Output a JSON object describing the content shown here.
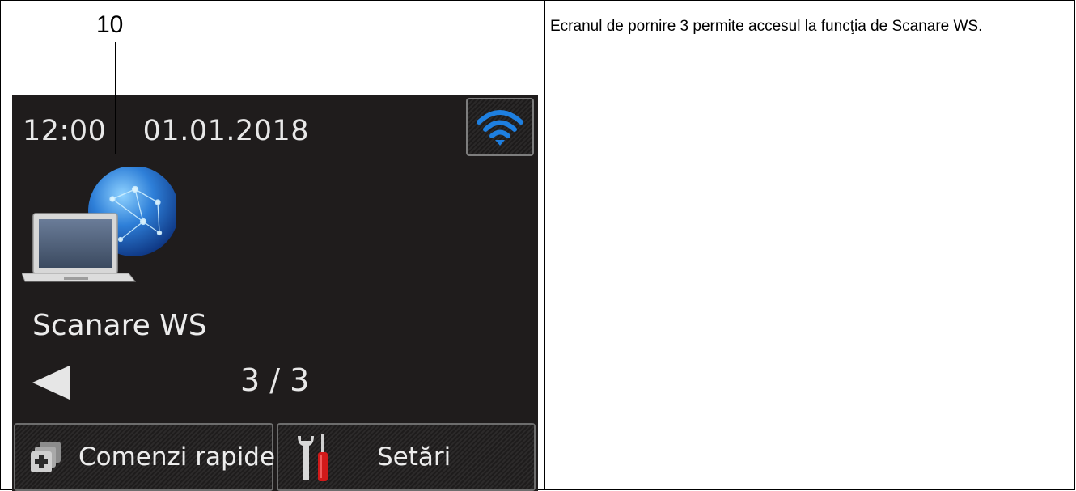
{
  "callout": {
    "number": "10"
  },
  "description": "Ecranul de pornire 3 permite accesul la funcţia de Scanare WS.",
  "screen": {
    "time": "12:00",
    "date": "01.01.2018",
    "wifi_icon": "wifi-icon",
    "app_icon": "laptop-globe-icon",
    "app_label": "Scanare WS",
    "prev_icon": "left-arrow-icon",
    "page_indicator": "3 / 3",
    "buttons": {
      "shortcuts_label": "Comenzi rapide",
      "shortcuts_icon": "shortcuts-plus-icon",
      "settings_label": "Setări",
      "settings_icon": "wrench-screwdriver-icon"
    }
  },
  "colors": {
    "screen_bg": "#1f1c1c",
    "wifi_blue": "#1e7fe0",
    "text_light": "#ececec"
  }
}
